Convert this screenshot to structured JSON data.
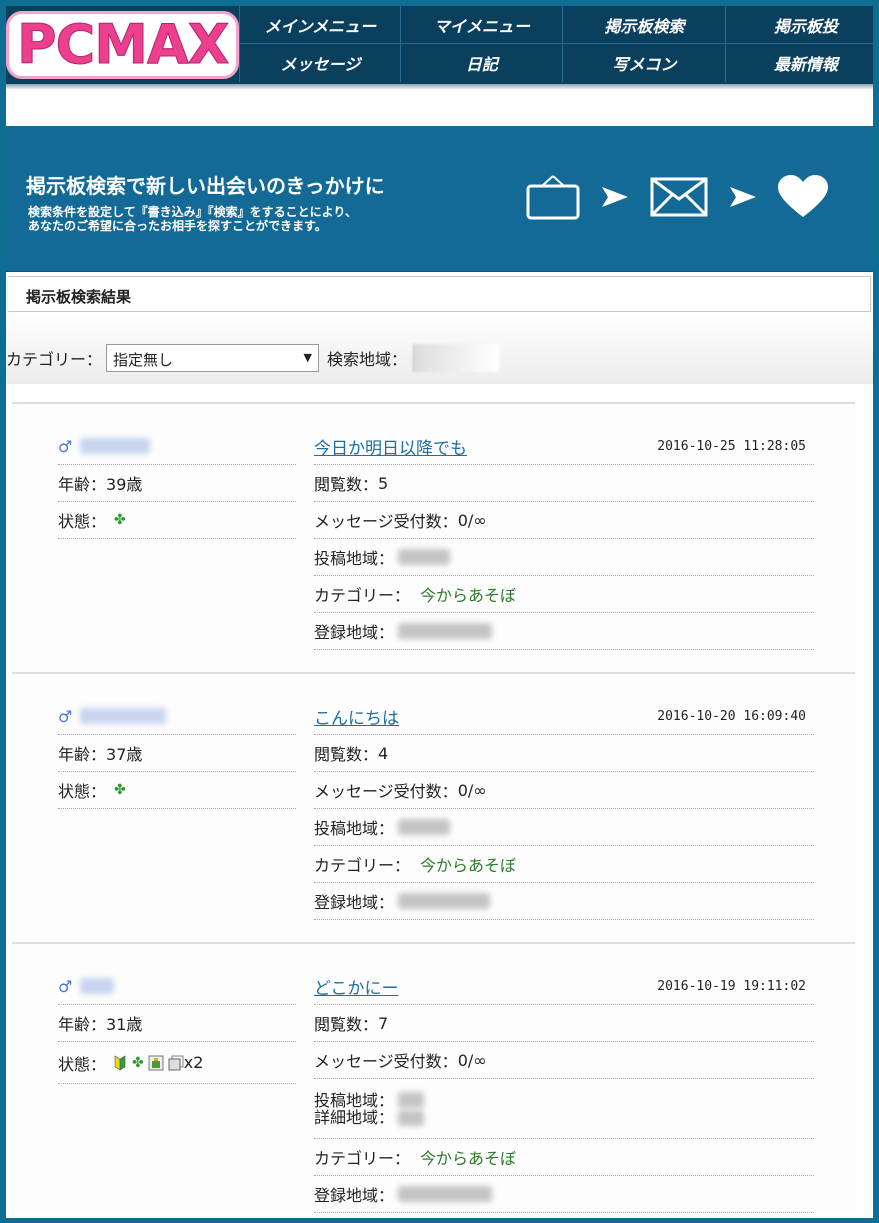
{
  "header": {
    "logo": "PCMAX",
    "nav_top": [
      "メインメニュー",
      "マイメニュー",
      "掲示板検索",
      "掲示板投"
    ],
    "nav_bottom": [
      "メッセージ",
      "日記",
      "写メコン",
      "最新情報"
    ]
  },
  "banner": {
    "title": "掲示板検索で新しい出会いのきっかけに",
    "sub1": "検索条件を設定して『書き込み』『検索』をすることにより、",
    "sub2": "あなたのご希望に合ったお相手を探すことができます。"
  },
  "section_title": "掲示板検索結果",
  "filter": {
    "category_label": "カテゴリー：",
    "category_value": "指定無し",
    "region_label": "検索地域："
  },
  "labels": {
    "age": "年齢：",
    "status": "状態：",
    "views": "閲覧数：",
    "messages": "メッセージ受付数：",
    "post_region": "投稿地域：",
    "detail_region": "詳細地域：",
    "category": "カテゴリー：",
    "reg_region": "登録地域："
  },
  "posts": [
    {
      "gender": "♂",
      "age": "39歳",
      "title": "今日か明日以降でも",
      "date": "2016-10-25 11:28:05",
      "views": "5",
      "messages": "0/∞",
      "category": "今からあそぼ"
    },
    {
      "gender": "♂",
      "age": "37歳",
      "title": "こんにちは",
      "date": "2016-10-20 16:09:40",
      "views": "4",
      "messages": "0/∞",
      "category": "今からあそぼ"
    },
    {
      "gender": "♂",
      "age": "31歳",
      "title": "どこかにー",
      "date": "2016-10-19 19:11:02",
      "views": "7",
      "messages": "0/∞",
      "category": "今からあそぼ",
      "photo_count": "x2"
    }
  ],
  "icons": {
    "status_icon": "clover-icon",
    "beginner_icon": "beginner-mark-icon",
    "photo_icon": "photo-icon",
    "accent_color": "#136a96"
  }
}
